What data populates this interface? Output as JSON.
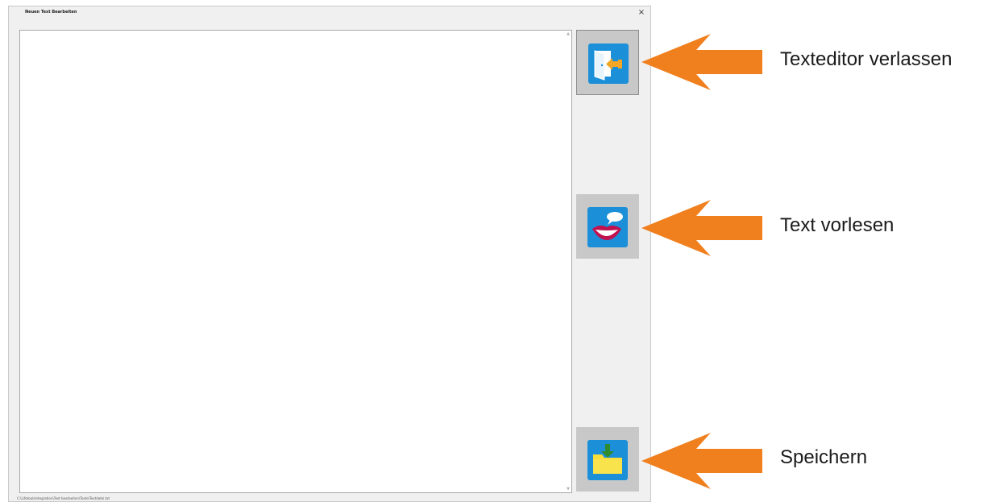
{
  "window": {
    "title": "Neuen Text Bearbeiten",
    "close_glyph": "×",
    "status_path": "C:\\LifetoolsIntegration\\Text bearbeiten\\Texte\\Textdatei.txt"
  },
  "text_area": {
    "value": "",
    "scroll_up": "▲",
    "scroll_down": "▼"
  },
  "buttons": {
    "exit": {
      "icon": "exit-door-icon"
    },
    "speak": {
      "icon": "speech-mouth-icon"
    },
    "save": {
      "icon": "save-folder-icon"
    }
  },
  "annotations": [
    {
      "label": "Texteditor verlassen"
    },
    {
      "label": "Text vorlesen"
    },
    {
      "label": "Speichern"
    }
  ],
  "colors": {
    "arrow": "#f07f1e",
    "icon_tile": "#1b8fd8",
    "button_bg": "#c8c8c8"
  }
}
